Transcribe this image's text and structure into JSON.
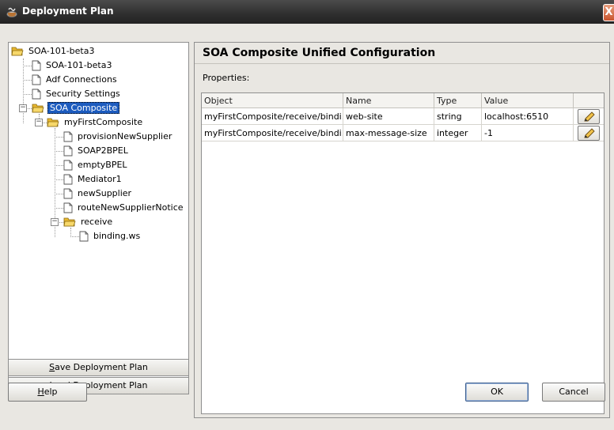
{
  "window": {
    "title": "Deployment Plan",
    "close_glyph": "X"
  },
  "tree": {
    "root": "SOA-101-beta3",
    "items": [
      "SOA-101-beta3",
      "Adf Connections",
      "Security Settings",
      "SOA Composite",
      "myFirstComposite",
      "provisionNewSupplier",
      "SOAP2BPEL",
      "emptyBPEL",
      "Mediator1",
      "newSupplier",
      "routeNewSupplierNotice",
      "receive",
      "binding.ws"
    ],
    "selected": "SOA Composite"
  },
  "left_buttons": {
    "save_mnemonic": "S",
    "save_rest": "ave Deployment Plan",
    "load_mnemonic": "L",
    "load_rest": "oad Deployment Plan"
  },
  "panel": {
    "title": "SOA Composite Unified Configuration",
    "properties_label": "Properties:"
  },
  "table": {
    "columns": [
      "Object",
      "Name",
      "Type",
      "Value"
    ],
    "rows": [
      {
        "object": "myFirstComposite/receive/bindi...",
        "name": "web-site",
        "type": "string",
        "value": "localhost:6510"
      },
      {
        "object": "myFirstComposite/receive/bindi...",
        "name": "max-message-size",
        "type": "integer",
        "value": "-1"
      }
    ]
  },
  "footer": {
    "help_mnemonic": "H",
    "help_rest": "elp",
    "ok": "OK",
    "cancel": "Cancel"
  },
  "icons": {
    "app": "coffee-cup-icon",
    "folder": "folder-open-icon",
    "file": "document-icon",
    "edit": "pencil-icon"
  },
  "colors": {
    "selection": "#1d5cbf",
    "titlebar": "#2f2f2f",
    "close": "#c9542e",
    "folder": "#f0c040"
  }
}
